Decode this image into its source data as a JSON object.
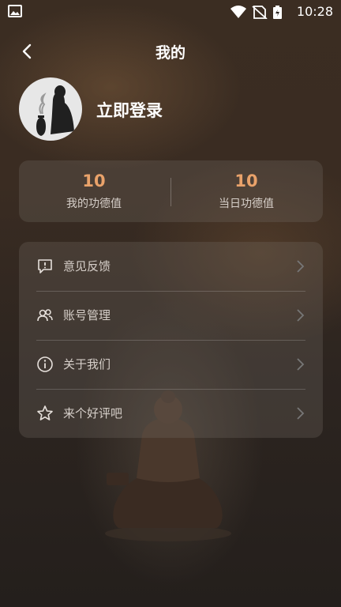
{
  "status": {
    "time": "10:28"
  },
  "header": {
    "title": "我的"
  },
  "profile": {
    "login_label": "立即登录"
  },
  "stats": [
    {
      "value": "10",
      "label": "我的功德值"
    },
    {
      "value": "10",
      "label": "当日功德值"
    }
  ],
  "menu": {
    "items": [
      {
        "label": "意见反馈",
        "icon": "feedback-icon"
      },
      {
        "label": "账号管理",
        "icon": "account-icon"
      },
      {
        "label": "关于我们",
        "icon": "info-icon"
      },
      {
        "label": "来个好评吧",
        "icon": "star-icon"
      }
    ]
  },
  "colors": {
    "accent": "#e9a26a",
    "text_muted": "#d6cfc9"
  }
}
